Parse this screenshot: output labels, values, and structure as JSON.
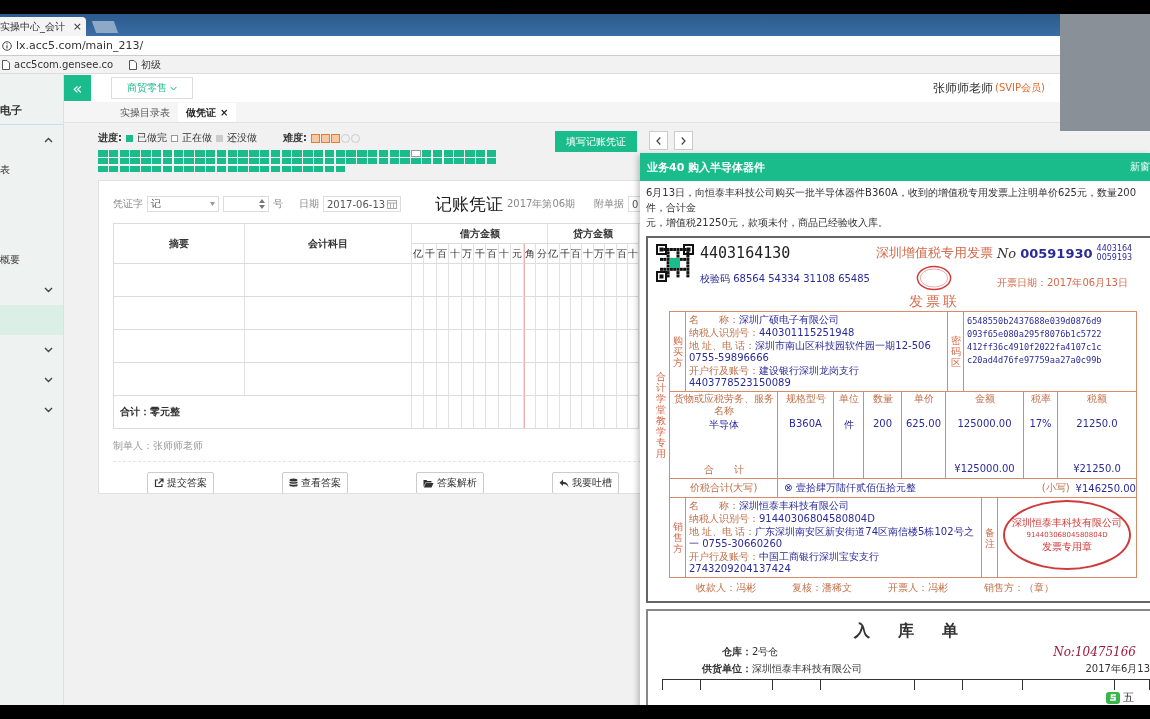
{
  "browser": {
    "tab_title": "实操中心_会计",
    "tab_close": "×",
    "url": "lx.acc5.com/main_213/",
    "bookmarks": [
      "acc5com.gensee.co",
      "初级"
    ]
  },
  "sidebar": {
    "title": "电子",
    "items": [
      {
        "kind": "group",
        "expanded": true,
        "selected": false
      },
      {
        "kind": "link",
        "label": "表",
        "selected": false
      },
      {
        "kind": "link",
        "label": "概要",
        "selected": false
      },
      {
        "kind": "group",
        "expanded": false,
        "selected": false
      },
      {
        "kind": "link",
        "selected": true
      },
      {
        "kind": "group",
        "expanded": false,
        "selected": false
      },
      {
        "kind": "group",
        "expanded": false,
        "selected": false
      },
      {
        "kind": "group",
        "expanded": false,
        "selected": false
      }
    ]
  },
  "header": {
    "collapse": "«",
    "industry": "商贸零售",
    "user": "张师师老师",
    "badge": "(SVIP会员)"
  },
  "tabs": [
    {
      "label": "实操目录表",
      "selected": false
    },
    {
      "label": "做凭证",
      "selected": true,
      "close": "×"
    }
  ],
  "progress": {
    "label": "进度:",
    "legend": [
      {
        "label": "已做完",
        "kind": "done"
      },
      {
        "label": "正在做",
        "kind": "current"
      },
      {
        "label": "还没做",
        "kind": "todo"
      }
    ],
    "difficulty_label": "难度:",
    "stars": 3,
    "tasks": [
      {
        "kind": "done"
      },
      {
        "kind": "done"
      },
      {
        "kind": "done"
      },
      {
        "kind": "done"
      },
      {
        "kind": "done"
      },
      {
        "kind": "done"
      },
      {
        "kind": "done"
      },
      {
        "kind": "done"
      },
      {
        "kind": "done"
      },
      {
        "kind": "done"
      },
      {
        "kind": "done"
      },
      {
        "kind": "done"
      },
      {
        "kind": "done"
      },
      {
        "kind": "done"
      },
      {
        "kind": "done"
      },
      {
        "kind": "done"
      },
      {
        "kind": "done"
      },
      {
        "kind": "done"
      },
      {
        "kind": "done"
      },
      {
        "kind": "done"
      },
      {
        "kind": "done"
      },
      {
        "kind": "done"
      },
      {
        "kind": "done"
      },
      {
        "kind": "done"
      },
      {
        "kind": "done"
      },
      {
        "kind": "done"
      },
      {
        "kind": "done"
      },
      {
        "kind": "done"
      },
      {
        "kind": "done"
      },
      {
        "kind": "current"
      },
      {
        "kind": "done"
      },
      {
        "kind": "done"
      },
      {
        "kind": "done"
      },
      {
        "kind": "done"
      },
      {
        "kind": "done"
      },
      {
        "kind": "done"
      },
      {
        "kind": "done"
      },
      {
        "kind": "done"
      },
      {
        "kind": "done"
      },
      {
        "kind": "done"
      },
      {
        "kind": "done"
      },
      {
        "kind": "done"
      },
      {
        "kind": "done"
      },
      {
        "kind": "done"
      },
      {
        "kind": "done"
      },
      {
        "kind": "done"
      },
      {
        "kind": "done"
      },
      {
        "kind": "done"
      },
      {
        "kind": "done"
      },
      {
        "kind": "done"
      },
      {
        "kind": "done"
      },
      {
        "kind": "done"
      },
      {
        "kind": "done"
      },
      {
        "kind": "done"
      },
      {
        "kind": "done"
      },
      {
        "kind": "done"
      },
      {
        "kind": "done"
      },
      {
        "kind": "done"
      },
      {
        "kind": "done"
      },
      {
        "kind": "done"
      },
      {
        "kind": "done"
      },
      {
        "kind": "done"
      },
      {
        "kind": "done"
      },
      {
        "kind": "done"
      },
      {
        "kind": "done"
      },
      {
        "kind": "done"
      },
      {
        "kind": "done"
      },
      {
        "kind": "done"
      },
      {
        "kind": "done"
      },
      {
        "kind": "done"
      },
      {
        "kind": "done"
      },
      {
        "kind": "done"
      },
      {
        "kind": "done"
      },
      {
        "kind": "done"
      },
      {
        "kind": "done"
      },
      {
        "kind": "done"
      },
      {
        "kind": "done"
      },
      {
        "kind": "done"
      },
      {
        "kind": "done"
      },
      {
        "kind": "done"
      },
      {
        "kind": "done"
      },
      {
        "kind": "done"
      },
      {
        "kind": "done"
      },
      {
        "kind": "done"
      },
      {
        "kind": "done"
      },
      {
        "kind": "done"
      },
      {
        "kind": "done"
      },
      {
        "kind": "done"
      },
      {
        "kind": "done"
      },
      {
        "kind": "done"
      },
      {
        "kind": "done"
      },
      {
        "kind": "done"
      },
      {
        "kind": "done"
      },
      {
        "kind": "done"
      },
      {
        "kind": "done"
      },
      {
        "kind": "done"
      },
      {
        "kind": "done"
      }
    ]
  },
  "fill_button": "填写记账凭证",
  "voucher": {
    "word_label": "凭证字",
    "word": "记",
    "number_suffix": "号",
    "date_label": "日期",
    "date": "2017-06-13",
    "title": "记账凭证",
    "period": "2017年第06期",
    "attach_label": "附单据",
    "attach": "0",
    "columns": {
      "summary": "摘要",
      "account": "会计科目",
      "debit": "借方金额",
      "credit": "贷方金额"
    },
    "debit_digits": [
      "亿",
      "千",
      "百",
      "十",
      "万",
      "千",
      "百",
      "十",
      "元",
      "角",
      "分"
    ],
    "credit_digits": [
      "亿",
      "千",
      "百",
      "十",
      "万",
      "千",
      "百",
      "十"
    ],
    "total": "合计：零元整",
    "maker": "制单人：张师师老师"
  },
  "actions": [
    {
      "label": "提交答案",
      "kind": "submit"
    },
    {
      "label": "查看答案",
      "kind": "view"
    },
    {
      "label": "答案解析",
      "kind": "explain"
    },
    {
      "label": "我要吐槽",
      "kind": "feedback"
    }
  ],
  "task_panel": {
    "title": "业务40 购入半导体器件",
    "new_window": "新窗",
    "description": [
      "6月13日，向恒泰丰科技公司购买一批半导体器件B360A，收到的增值税专用发票上注明单价625元，数量200件，合计金",
      "元，增值税21250元，款项未付，商品已经验收入库。"
    ],
    "invoice": {
      "code": "4403164130",
      "title": "深圳增值税专用发票",
      "copy": "发票联",
      "no_label": "No",
      "number": "00591930",
      "side_numbers": [
        "4403164",
        "0059193"
      ],
      "check_code": "校验码 68564 54334 31108 65485",
      "date": "开票日期：2017年06月13日",
      "margin_text": "合计学堂教学专用",
      "buyer": {
        "label": "购买方",
        "fields": [
          {
            "label": "名　　称：",
            "value": "深圳广硕电子有限公司"
          },
          {
            "label": "纳税人识别号：",
            "value": "440301115251948"
          },
          {
            "label": "地 址、电 话：",
            "value": "深圳市南山区科技园软件园一期12-506 0755-59896666"
          },
          {
            "label": "开户行及账号：",
            "value": "建设银行深圳龙岗支行 4403778523150089"
          }
        ]
      },
      "cipher_label": "密码区",
      "cipher": [
        "6548550b2437688e039d0876d9",
        "093f65e080a295f8076b1c5722",
        "412ff36c4910f2022fa4107c1c",
        "c20ad4d76fe97759aa27a0c99b"
      ],
      "goods_columns": [
        "货物或应税劳务、服务名称",
        "规格型号",
        "单位",
        "数量",
        "单价",
        "金额",
        "税率",
        "税额"
      ],
      "goods_row": [
        "半导体",
        "B360A",
        "件",
        "200",
        "625.00",
        "125000.00",
        "17%",
        "21250.0"
      ],
      "total_label": "合　　计",
      "total_amount": "¥125000.00",
      "total_tax": "¥21250.0",
      "sum_label": "价税合计(大写)",
      "sum_words": "⊗ 壹拾肆万陆仟贰佰伍拾元整",
      "sum_small_label": "(小写)",
      "sum_value": "¥146250.00",
      "seller": {
        "label": "销售方",
        "fields": [
          {
            "label": "名　　称：",
            "value": "深圳恒泰丰科技有限公司"
          },
          {
            "label": "纳税人识别号：",
            "value": "91440306804580804D"
          },
          {
            "label": "地 址、电 话：",
            "value": "广东深圳南安区新安街道74区南信楼5栋102号之一 0755-30660260"
          },
          {
            "label": "开户行及账号：",
            "value": "中国工商银行深圳宝安支行 2743209204137424"
          }
        ]
      },
      "remark_label": "备注",
      "seal": [
        "深圳恒泰丰科技有限公司",
        "91440306804580804D",
        "发票专用章"
      ],
      "footer": [
        "收款人：冯彬",
        "复核：潘稀文",
        "开票人：冯彬",
        "销售方：（章）"
      ]
    },
    "receipt": {
      "title": "入 库 单",
      "warehouse_label": "仓库：",
      "warehouse": "2号仓",
      "number": "No:10475166",
      "supplier_label": "供货单位：",
      "supplier": "深圳恒泰丰科技有限公司",
      "date": "2017年6月13"
    }
  },
  "ime": "五"
}
